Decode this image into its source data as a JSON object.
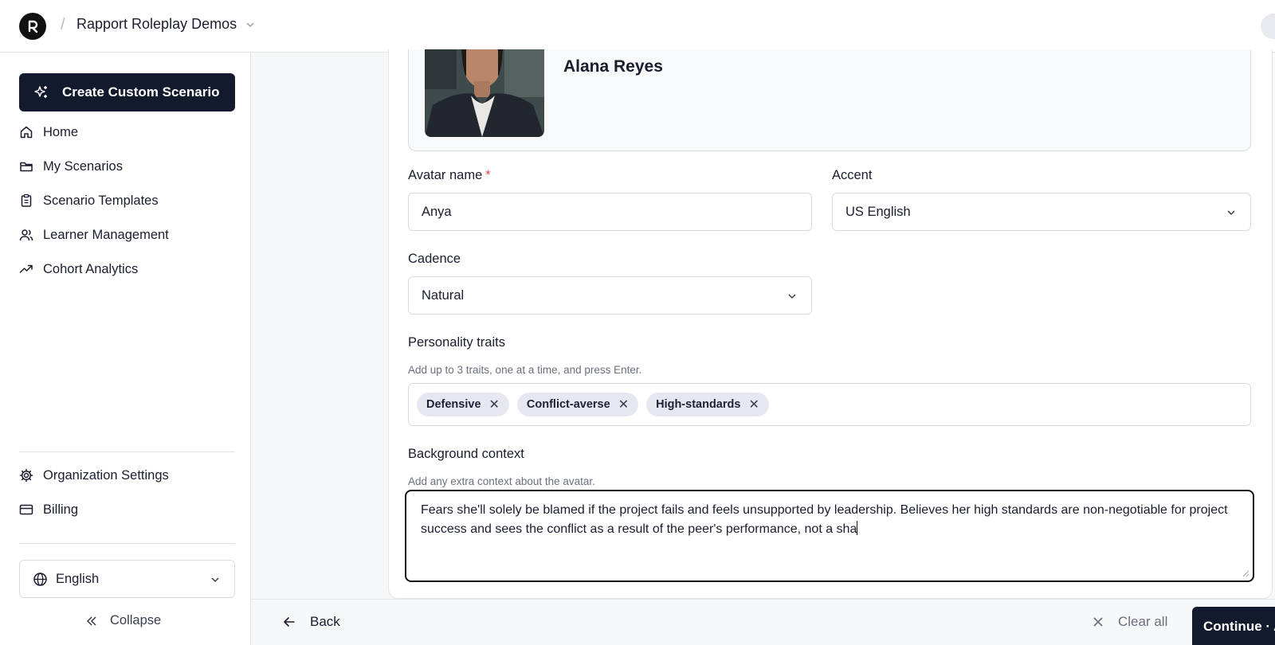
{
  "header": {
    "workspace_name": "Rapport Roleplay Demos",
    "separator": "/"
  },
  "sidebar": {
    "create_button": "Create Custom Scenario",
    "nav": [
      {
        "label": "Home",
        "icon": "home-icon"
      },
      {
        "label": "My Scenarios",
        "icon": "folder-icon"
      },
      {
        "label": "Scenario Templates",
        "icon": "clipboard-icon"
      },
      {
        "label": "Learner Management",
        "icon": "users-icon"
      },
      {
        "label": "Cohort Analytics",
        "icon": "trend-icon"
      }
    ],
    "bottom_nav": [
      {
        "label": "Organization Settings",
        "icon": "gear-icon"
      },
      {
        "label": "Billing",
        "icon": "credit-card-icon"
      }
    ],
    "language": "English",
    "collapse": "Collapse"
  },
  "avatar_card": {
    "name": "Alana Reyes"
  },
  "form": {
    "avatar_name_label": "Avatar name",
    "required_mark": "*",
    "avatar_name_value": "Anya",
    "accent_label": "Accent",
    "accent_value": "US English",
    "cadence_label": "Cadence",
    "cadence_value": "Natural",
    "traits_label": "Personality traits",
    "traits_help": "Add up to 3 traits, one at a time, and press Enter.",
    "traits": [
      "Defensive",
      "Conflict-averse",
      "High-standards"
    ],
    "background_label": "Background context",
    "background_help": "Add any extra context about the avatar.",
    "background_value": "Fears she'll solely be blamed if the project fails and feels unsupported by leadership. Believes her high standards are non-negotiable for project success and sees the conflict as a result of the peer's performance, not a sha"
  },
  "footer": {
    "back": "Back",
    "clear_all": "Clear all",
    "continue": "Continue · A"
  },
  "colors": {
    "primary": "#141a2e",
    "required": "#e0475a",
    "tag_bg": "#e6e7f0"
  }
}
